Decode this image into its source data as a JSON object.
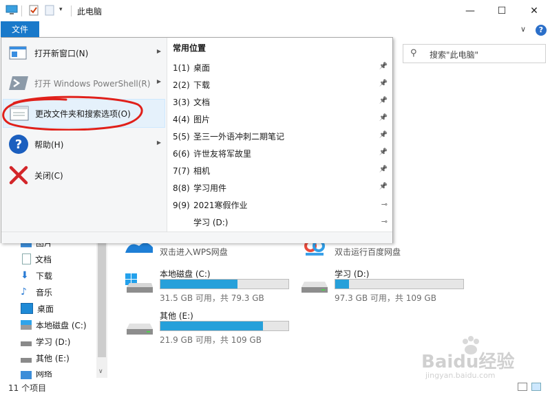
{
  "window": {
    "title": "此电脑",
    "minimize": "—",
    "maximize": "☐",
    "close": "✕"
  },
  "ribbon": {
    "file_tab": "文件",
    "help": "?",
    "collapse": "∨"
  },
  "search": {
    "placeholder": "搜索\"此电脑\""
  },
  "file_menu": {
    "items": [
      {
        "label": "打开新窗口(N)",
        "icon": "new-window-icon",
        "has_submenu": true,
        "enabled": true
      },
      {
        "label": "打开 Windows PowerShell(R)",
        "icon": "powershell-icon",
        "has_submenu": true,
        "enabled": false
      },
      {
        "label": "更改文件夹和搜索选项(O)",
        "icon": "folder-options-icon",
        "has_submenu": false,
        "enabled": true
      },
      {
        "label": "帮助(H)",
        "icon": "help-icon",
        "has_submenu": true,
        "enabled": true
      },
      {
        "label": "关闭(C)",
        "icon": "close-red-x-icon",
        "has_submenu": false,
        "enabled": true
      }
    ],
    "common_header": "常用位置",
    "common_places": [
      {
        "index": "1(1)",
        "name": "桌面",
        "pinned": true
      },
      {
        "index": "2(2)",
        "name": "下载",
        "pinned": true
      },
      {
        "index": "3(3)",
        "name": "文档",
        "pinned": true
      },
      {
        "index": "4(4)",
        "name": "图片",
        "pinned": true
      },
      {
        "index": "5(5)",
        "name": "圣三一外语冲刺二期笔记",
        "pinned": true
      },
      {
        "index": "6(6)",
        "name": "许世友将军故里",
        "pinned": true
      },
      {
        "index": "7(7)",
        "name": "相机",
        "pinned": true
      },
      {
        "index": "8(8)",
        "name": "学习用件",
        "pinned": true
      },
      {
        "index": "9(9)",
        "name": "2021寒假作业",
        "pinned": false
      },
      {
        "index": "",
        "name": "学习 (D:)",
        "pinned": false
      }
    ]
  },
  "nav_pane": {
    "items": [
      {
        "label": "图片",
        "icon": "pictures-icon"
      },
      {
        "label": "文档",
        "icon": "documents-icon"
      },
      {
        "label": "下载",
        "icon": "download-arrow-icon"
      },
      {
        "label": "音乐",
        "icon": "music-note-icon"
      },
      {
        "label": "桌面",
        "icon": "desktop-icon"
      },
      {
        "label": "本地磁盘 (C:)",
        "icon": "windows-drive-icon"
      },
      {
        "label": "学习 (D:)",
        "icon": "drive-icon"
      },
      {
        "label": "其他 (E:)",
        "icon": "drive-icon"
      },
      {
        "label": "网络",
        "icon": "network-icon"
      }
    ]
  },
  "cloud_items": [
    {
      "label": "双击进入WPS网盘",
      "icon": "wps-cloud-icon"
    },
    {
      "label": "双击运行百度网盘",
      "icon": "baidu-netdisk-icon"
    }
  ],
  "drives": [
    {
      "name": "本地磁盘 (C:)",
      "info": "31.5 GB 可用，共 79.3 GB",
      "used_fraction": 0.6,
      "icon": "windows-drive-icon"
    },
    {
      "name": "学习 (D:)",
      "info": "97.3 GB 可用，共 109 GB",
      "used_fraction": 0.11,
      "icon": "drive-icon"
    },
    {
      "name": "其他 (E:)",
      "info": "21.9 GB 可用，共 109 GB",
      "used_fraction": 0.8,
      "icon": "drive-icon"
    }
  ],
  "status": {
    "count": "11 个项目"
  },
  "colors": {
    "accent": "#1979ca",
    "bar_fill": "#26a0da",
    "annotation": "#e0201a"
  },
  "watermark": {
    "text": "Baidu经验",
    "url_text": "jingyan.baidu.com"
  }
}
